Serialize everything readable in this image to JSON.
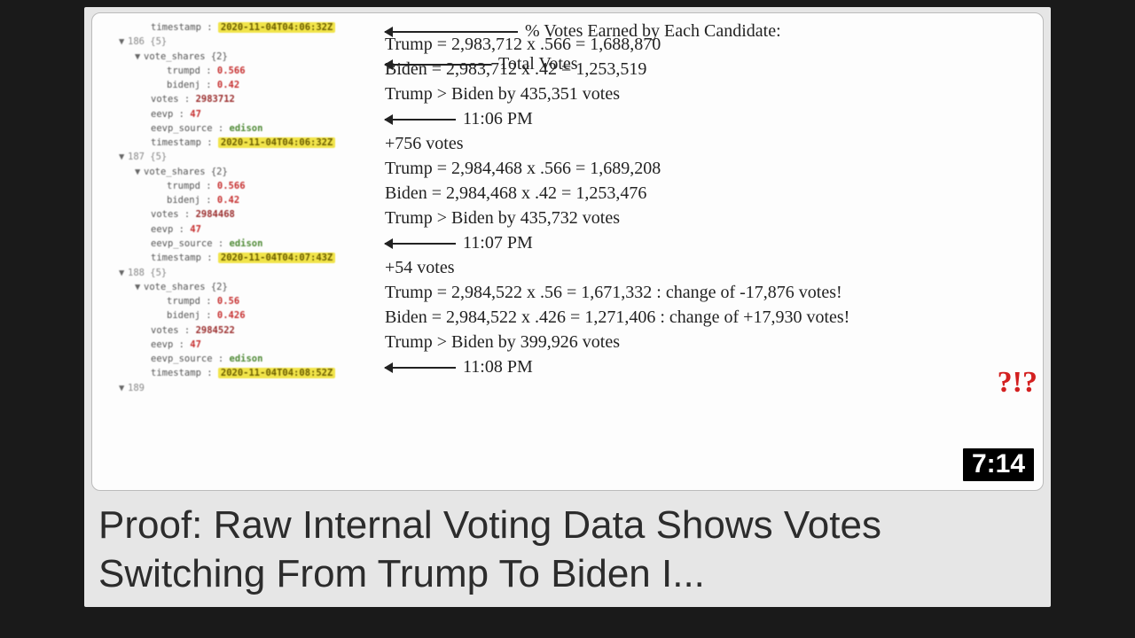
{
  "video": {
    "title": "Proof: Raw Internal Voting Data Shows Votes Switching From Trump To Biden I...",
    "duration": "7:14",
    "exclaim": "?!?"
  },
  "tree": {
    "top_timestamp_label": "timestamp :",
    "top_timestamp_val": "2020-11-04T04:06:32Z",
    "blocks": [
      {
        "idx_label": "186 {5}",
        "vote_shares_label": "vote_shares {2}",
        "trump_key": "trumpd :",
        "trump_val": "0.566",
        "biden_key": "bidenj :",
        "biden_val": "0.42",
        "votes_key": "votes :",
        "votes_val": "2983712",
        "eevp_key": "eevp :",
        "eevp_val": "47",
        "src_key": "eevp_source :",
        "src_val": "edison",
        "ts_key": "timestamp :",
        "ts_val": "2020-11-04T04:06:32Z"
      },
      {
        "idx_label": "187 {5}",
        "vote_shares_label": "vote_shares {2}",
        "trump_key": "trumpd :",
        "trump_val": "0.566",
        "biden_key": "bidenj :",
        "biden_val": "0.42",
        "votes_key": "votes :",
        "votes_val": "2984468",
        "eevp_key": "eevp :",
        "eevp_val": "47",
        "src_key": "eevp_source :",
        "src_val": "edison",
        "ts_key": "timestamp :",
        "ts_val": "2020-11-04T04:07:43Z"
      },
      {
        "idx_label": "188 {5}",
        "vote_shares_label": "vote_shares {2}",
        "trump_key": "trumpd :",
        "trump_val": "0.56",
        "biden_key": "bidenj :",
        "biden_val": "0.426",
        "votes_key": "votes :",
        "votes_val": "2984522",
        "eevp_key": "eevp :",
        "eevp_val": "47",
        "src_key": "eevp_source :",
        "src_val": "edison",
        "ts_key": "timestamp :",
        "ts_val": "2020-11-04T04:08:52Z"
      }
    ],
    "tail_label": "189"
  },
  "anno": {
    "pct_label": "% Votes Earned by Each Candidate:",
    "total_label": "Total Votes",
    "calc1_trump": "Trump = 2,983,712 x .566 = 1,688,870",
    "calc1_biden": "Biden = 2,983,712 x .42 = 1,253,519",
    "calc1_diff": "Trump > Biden by 435,351 votes",
    "time1": "11:06 PM",
    "delta1": "+756 votes",
    "calc2_trump": "Trump = 2,984,468 x .566 = 1,689,208",
    "calc2_biden": "Biden = 2,984,468 x .42 = 1,253,476",
    "calc2_diff": "Trump > Biden by 435,732 votes",
    "time2": "11:07 PM",
    "delta2": "+54 votes",
    "calc3_trump": "Trump = 2,984,522 x .56 = 1,671,332 : change of -17,876 votes!",
    "calc3_biden": "Biden = 2,984,522 x .426 = 1,271,406 : change of +17,930 votes!",
    "calc3_diff": "Trump > Biden by 399,926 votes",
    "time3": "11:08 PM"
  }
}
